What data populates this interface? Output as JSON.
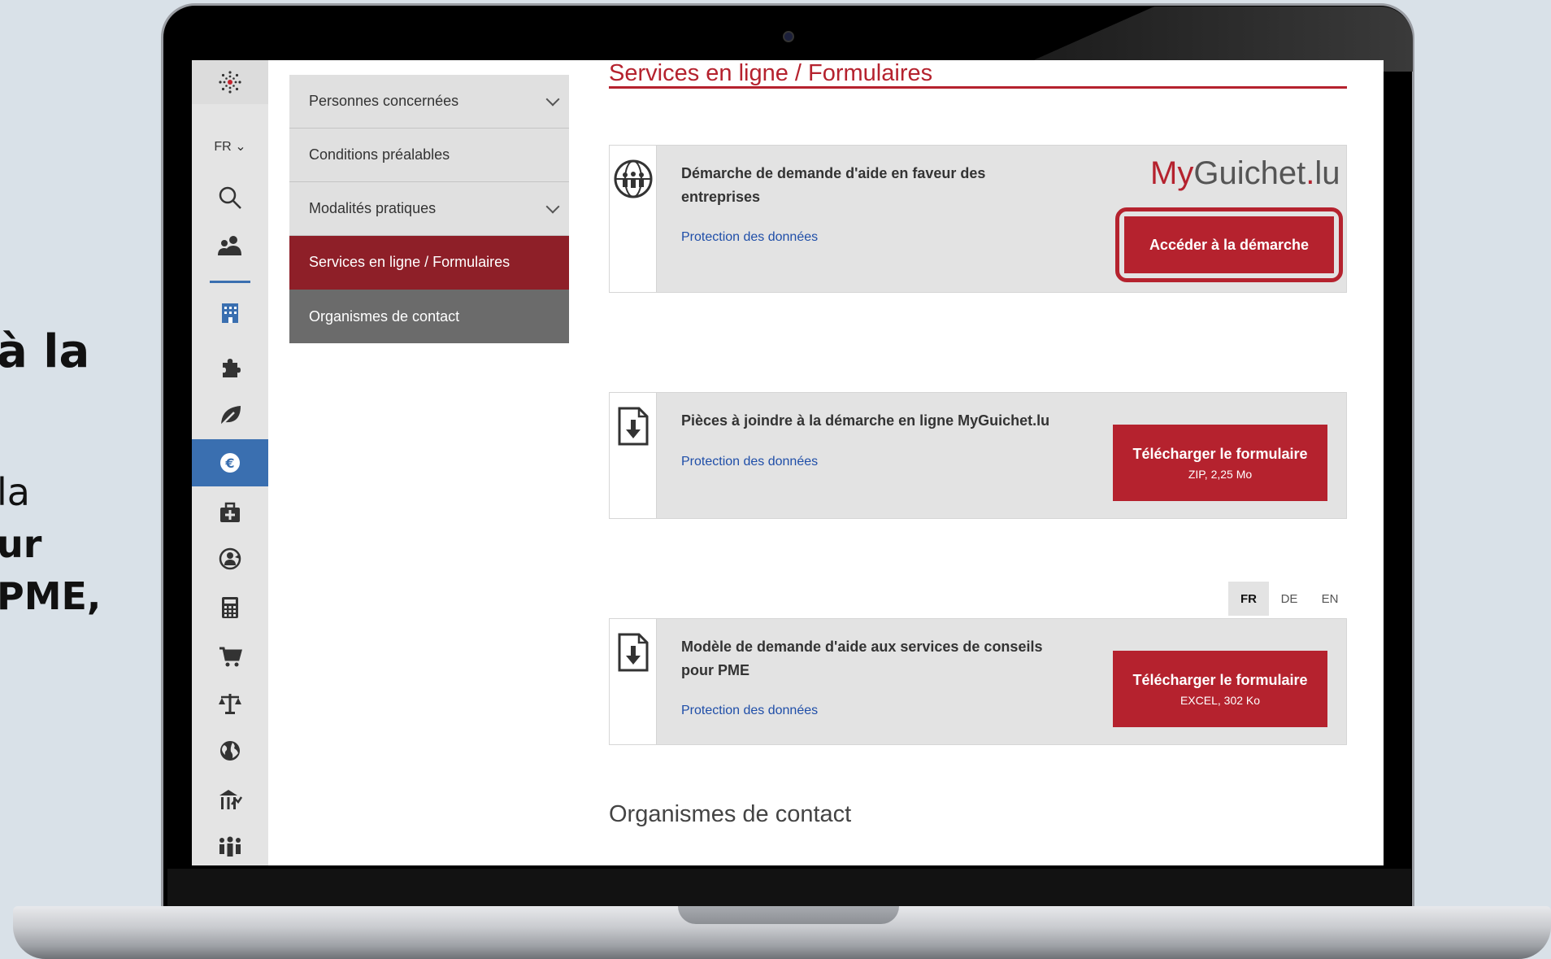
{
  "background_text": {
    "line1": "à la",
    "line2": "la",
    "line3": "ur",
    "line4": "PME,"
  },
  "rail": {
    "language": "FR",
    "icons": [
      "logo-icon",
      "search-icon",
      "people-icon",
      "building-icon",
      "puzzle-icon",
      "leaf-icon",
      "euro-icon",
      "medical-kit-icon",
      "user-cycle-icon",
      "calculator-icon",
      "cart-icon",
      "scales-icon",
      "globe-icon",
      "bank-chart-icon",
      "group-icon"
    ],
    "active_icon": "euro-icon"
  },
  "menu": {
    "items": [
      {
        "label": "Personnes concernées",
        "expandable": true
      },
      {
        "label": "Conditions préalables",
        "expandable": false
      },
      {
        "label": "Modalités pratiques",
        "expandable": true
      },
      {
        "label": "Services en ligne / Formulaires",
        "expandable": false
      },
      {
        "label": "Organismes de contact",
        "expandable": false
      }
    ]
  },
  "section": {
    "title": "Services en ligne / Formulaires"
  },
  "cards": [
    {
      "title": "Démarche de demande d'aide en faveur des entreprises",
      "link": "Protection des données",
      "brand_my": "My",
      "brand_rest": "Guichet",
      "brand_dot": ".",
      "brand_tld": "lu",
      "button": "Accéder à la démarche"
    },
    {
      "title": "Pièces à joindre à la démarche en ligne MyGuichet.lu",
      "link": "Protection des données",
      "button": "Télécharger le formulaire",
      "button_sub": "ZIP, 2,25 Mo"
    },
    {
      "title": "Modèle de demande d'aide aux services de conseils pour PME",
      "link": "Protection des données",
      "button": "Télécharger le formulaire",
      "button_sub": "EXCEL, 302 Ko"
    }
  ],
  "lang_tabs": [
    "FR",
    "DE",
    "EN"
  ],
  "contact_heading": "Organismes de contact",
  "colors": {
    "brand_red": "#b5222e",
    "menu_active": "#8e1f28",
    "rail_active": "#3a6fb0",
    "link_blue": "#1f4ea8"
  }
}
